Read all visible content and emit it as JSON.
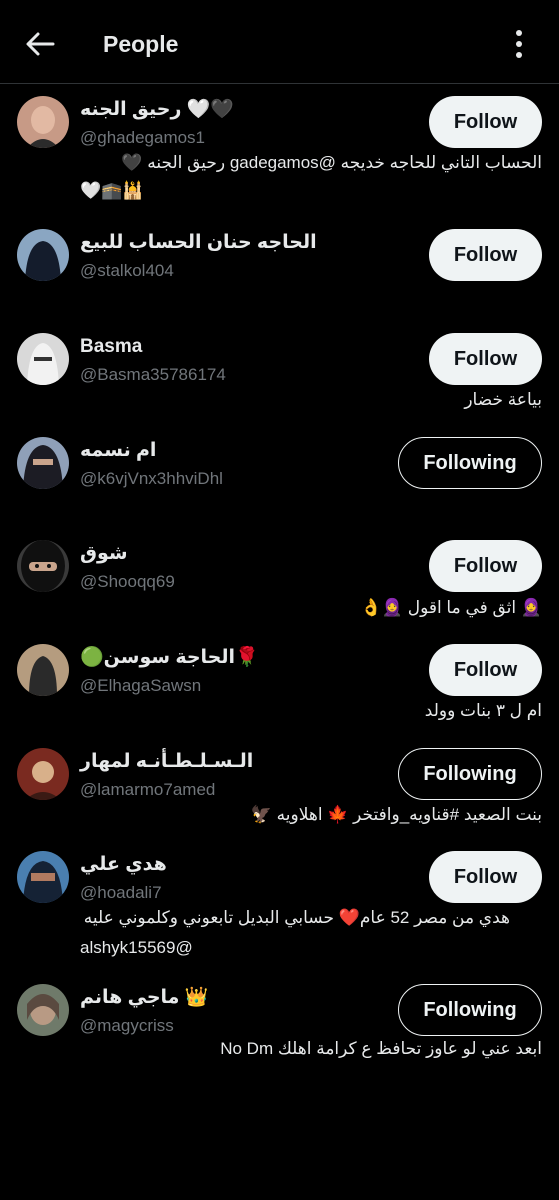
{
  "header": {
    "title": "People"
  },
  "users": [
    {
      "name": "رحيق الجنه 🤍🖤",
      "handle": "@ghadegamos1",
      "bio_lines": [
        "الحساب التاني للحاجه خديجه @gadegamos رحيق الجنه 🖤",
        "🤍🕋🕌"
      ],
      "button": "Follow",
      "avatar_colors": [
        "#c79a86",
        "#2b2b2b"
      ]
    },
    {
      "name": "الحاجه حنان الحساب للبيع",
      "handle": "@stalkol404",
      "bio_lines": [],
      "button": "Follow",
      "avatar_colors": [
        "#8aa6c2",
        "#141c2c"
      ]
    },
    {
      "name": "Basma",
      "handle": "@Basma35786174",
      "bio_lines": [
        "بياعة خضار"
      ],
      "button": "Follow",
      "avatar_colors": [
        "#d9d9d9",
        "#f2f2f2"
      ]
    },
    {
      "name": "ام نسمه",
      "handle": "@k6vjVnx3hhviDhl",
      "bio_lines": [],
      "button": "Following",
      "avatar_colors": [
        "#8fa0b8",
        "#1c1c24"
      ]
    },
    {
      "name": "شوق",
      "handle": "@Shooqq69",
      "bio_lines": [
        "🧕 اثق في ما اقول 🧕👌"
      ],
      "button": "Follow",
      "avatar_colors": [
        "#3a3a3a",
        "#101010"
      ]
    },
    {
      "name": "🟢الحاجة سوسن🌹",
      "handle": "@ElhagaSawsn",
      "bio_lines": [
        "ام ل ٣ بنات وولد"
      ],
      "button": "Follow",
      "avatar_colors": [
        "#b59c7f",
        "#2a2a2a"
      ]
    },
    {
      "name": "الـسـلـطـأنـه لمهار",
      "handle": "@lamarmo7amed",
      "bio_lines": [
        "بنت الصعيد #قناويه_وافتخر 🍁 اهلاويه 🦅"
      ],
      "button": "Following",
      "avatar_colors": [
        "#7a2a20",
        "#d8b08a"
      ]
    },
    {
      "name": "هدي علي",
      "handle": "@hoadali7",
      "bio_lines": [
        "هدي من مصر 52 عام❤️ حسابي البديل تابعوني وكلموني عليه",
        "alshyk15569@"
      ],
      "button": "Follow",
      "avatar_colors": [
        "#4a7fb0",
        "#152235"
      ]
    },
    {
      "name": "ماجي هانم 👑",
      "handle": "@magycriss",
      "bio_lines": [
        "ابعد عني لو عاوز تحافظ ع كرامة اهلك    No Dm"
      ],
      "button": "Following",
      "avatar_colors": [
        "#b89a84",
        "#5a4a40"
      ]
    }
  ],
  "colors": {
    "background": "#000000",
    "text": "#e7e9ea",
    "secondary": "#71767b",
    "follow_bg": "#eff3f4",
    "divider": "#2f3336"
  },
  "icons": {
    "back": "arrow-left-icon",
    "more": "more-vertical-icon"
  }
}
